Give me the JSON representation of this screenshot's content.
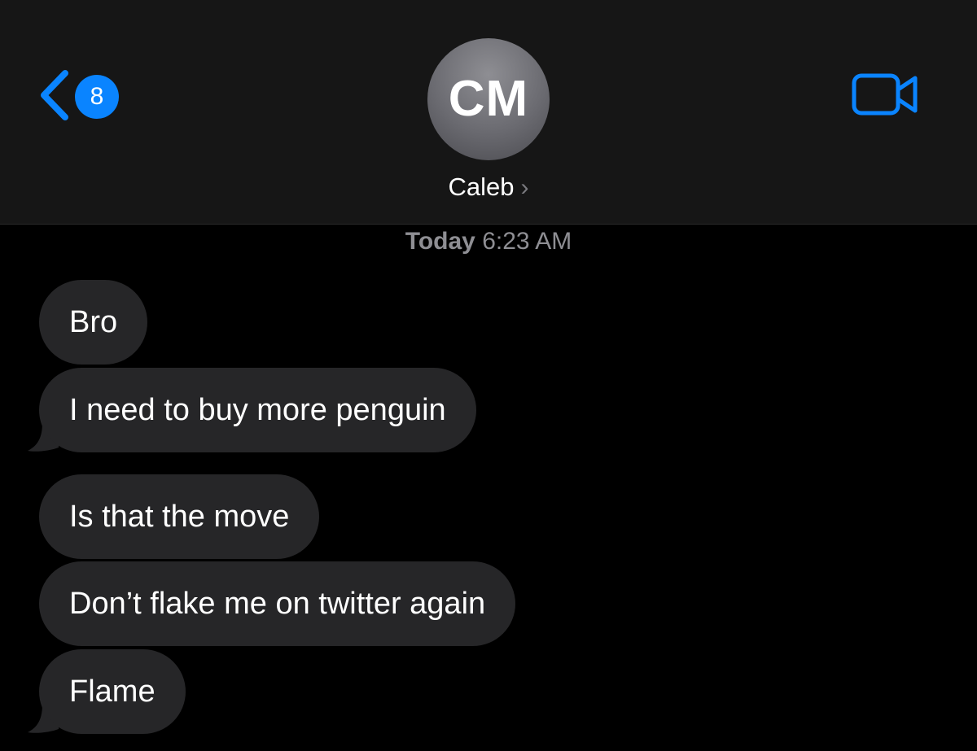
{
  "header": {
    "back_badge_count": "8",
    "avatar_initials": "CM",
    "contact_name": "Caleb",
    "contact_chevron": "›",
    "back_icon": "chevron-left-icon",
    "video_icon": "video-camera-icon"
  },
  "thread": {
    "timestamp_day": "Today",
    "timestamp_time": "6:23 AM",
    "messages": [
      {
        "text": "Bro",
        "direction": "incoming"
      },
      {
        "text": "I need to buy more penguin",
        "direction": "incoming"
      },
      {
        "text": "Is that the move",
        "direction": "incoming"
      },
      {
        "text": "Don’t flake me on twitter again",
        "direction": "incoming"
      },
      {
        "text": "Flame",
        "direction": "incoming"
      }
    ]
  },
  "colors": {
    "accent": "#0a84ff",
    "bubble_incoming": "#262628",
    "header_bg": "#161616",
    "background": "#000000",
    "secondary_text": "#8e8e93"
  }
}
